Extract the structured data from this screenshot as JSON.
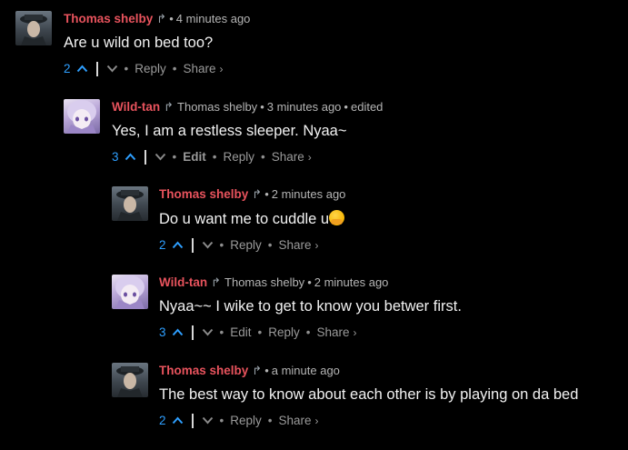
{
  "comments": [
    {
      "author": "Thomas shelby",
      "reply_to": "",
      "time": "4 minutes ago",
      "edited": "",
      "text": "Are u wild on bed too?",
      "votes": "2",
      "edit_label": "",
      "reply_label": "Reply",
      "share_label": "Share",
      "avatar": "peaky-avatar"
    },
    {
      "author": "Wild-tan",
      "reply_to": "Thomas shelby",
      "time": "3 minutes ago",
      "edited": "edited",
      "text": "Yes, I am a restless sleeper. Nyaa~",
      "votes": "3",
      "edit_label": "Edit",
      "reply_label": "Reply",
      "share_label": "Share",
      "avatar": "anime-avatar"
    },
    {
      "author": "Thomas shelby",
      "reply_to": "",
      "time": "2 minutes ago",
      "edited": "",
      "text": "Do u want me to cuddle u",
      "emoji": "hugging-face-emoji",
      "votes": "2",
      "edit_label": "",
      "reply_label": "Reply",
      "share_label": "Share",
      "avatar": "peaky-avatar"
    },
    {
      "author": "Wild-tan",
      "reply_to": "Thomas shelby",
      "time": "2 minutes ago",
      "edited": "",
      "text": "Nyaa~~ I wike to get to know you betwer first.",
      "votes": "3",
      "edit_label": "Edit",
      "reply_label": "Reply",
      "share_label": "Share",
      "avatar": "anime-avatar"
    },
    {
      "author": "Thomas shelby",
      "reply_to": "",
      "time": "a minute ago",
      "edited": "",
      "text": "The best way to know about each other is by playing on da bed",
      "votes": "2",
      "edit_label": "",
      "reply_label": "Reply",
      "share_label": "Share",
      "avatar": "peaky-avatar"
    }
  ],
  "icons": {
    "reply_arrow": "↱",
    "upvote": "⌃",
    "downvote": "⌄",
    "share_chevron": "›",
    "bullet": "•"
  },
  "colors": {
    "background": "#000000",
    "author": "#e8535d",
    "vote_blue": "#2e9fff",
    "muted": "#8f8f8f"
  }
}
